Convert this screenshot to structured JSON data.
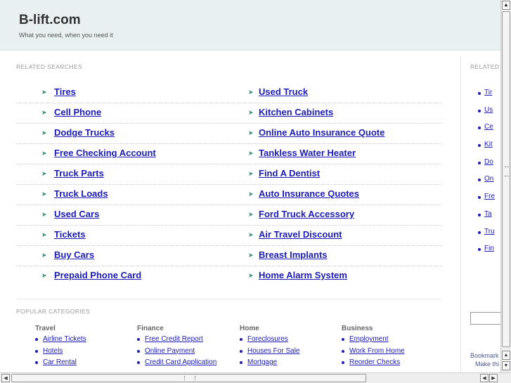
{
  "header": {
    "title": "B-lift.com",
    "tagline": "What you need, when you need it"
  },
  "related": {
    "label": "RELATED SEARCHES",
    "left": [
      "Tires",
      "Cell Phone",
      "Dodge Trucks",
      "Free Checking Account",
      "Truck Parts",
      "Truck Loads",
      "Used Cars",
      "Tickets",
      "Buy Cars",
      "Prepaid Phone Card"
    ],
    "right": [
      "Used Truck",
      "Kitchen Cabinets",
      "Online Auto Insurance Quote",
      "Tankless Water Heater",
      "Find A Dentist",
      "Auto Insurance Quotes",
      "Ford Truck Accessory",
      "Air Travel Discount",
      "Breast Implants",
      "Home Alarm System"
    ]
  },
  "popular": {
    "label": "POPULAR CATEGORIES",
    "categories": [
      {
        "title": "Travel",
        "items": [
          "Airline Tickets",
          "Hotels",
          "Car Rental"
        ]
      },
      {
        "title": "Finance",
        "items": [
          "Free Credit Report",
          "Online Payment",
          "Credit Card Application"
        ]
      },
      {
        "title": "Home",
        "items": [
          "Foreclosures",
          "Houses For Sale",
          "Mortgage"
        ]
      },
      {
        "title": "Business",
        "items": [
          "Employment",
          "Work From Home",
          "Reorder Checks"
        ]
      }
    ]
  },
  "sidebar": {
    "label": "RELATED",
    "items": [
      "Tir",
      "Us",
      "Ce",
      "Kit",
      "Do",
      "On",
      "Fre",
      "Ta",
      "Tru",
      "Fin"
    ],
    "bookmark_line1": "Bookmark",
    "bookmark_line2": "Make thi"
  },
  "colors": {
    "link": "#1c1cb4",
    "arrow": "#2b8c70",
    "header_bg": "#e9f0f2"
  },
  "icons": {
    "list_arrow": "arrow-right-icon",
    "bullet": "bullet-dot-icon"
  }
}
